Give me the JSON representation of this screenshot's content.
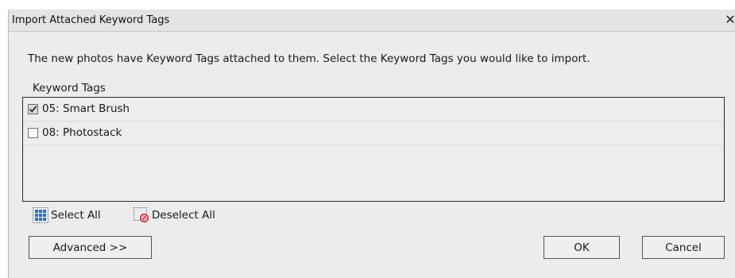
{
  "dialog": {
    "title": "Import Attached Keyword Tags",
    "close_glyph": "✕",
    "instruction": "The new photos have Keyword Tags attached to them.  Select the Keyword Tags you would like to import.",
    "list_label": "Keyword Tags",
    "tags": [
      {
        "label": "05: Smart Brush",
        "checked": true
      },
      {
        "label": "08: Photostack",
        "checked": false
      }
    ],
    "select_all_label": "Select All",
    "deselect_all_label": "Deselect All",
    "advanced_label": "Advanced >>",
    "ok_label": "OK",
    "cancel_label": "Cancel"
  },
  "icons": {
    "close": "close-icon",
    "select_all": "select-all-grid-icon",
    "deselect_all": "deselect-all-icon",
    "checkbox_checked": "checkmark-icon"
  },
  "colors": {
    "dialog_background": "#ececec",
    "select_all_icon": "#2f6fc9",
    "deselect_all_icon": "#d9262b"
  }
}
